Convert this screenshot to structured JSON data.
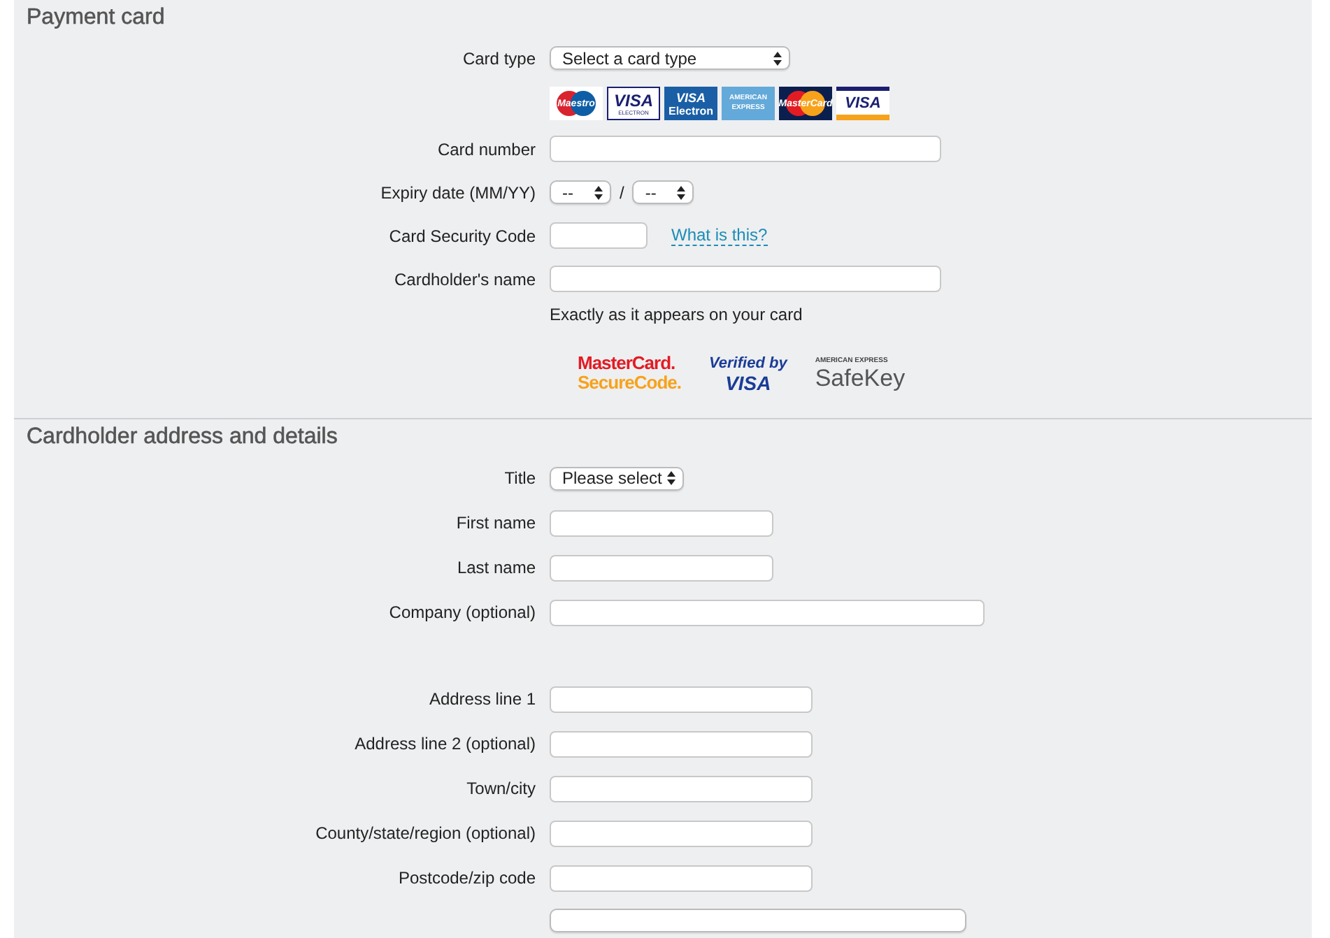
{
  "payment_card": {
    "title": "Payment card",
    "card_type": {
      "label": "Card type",
      "value": "Select a card type"
    },
    "card_logos": [
      {
        "kind": "maestro",
        "label": "Maestro"
      },
      {
        "kind": "visa",
        "label": "VISA",
        "sub": "ELECTRON"
      },
      {
        "kind": "electron",
        "label": "VISA",
        "sub": "Electron"
      },
      {
        "kind": "amex",
        "label": "AMERICAN",
        "sub": "EXPRESS"
      },
      {
        "kind": "mastercard",
        "label": "MasterCard"
      },
      {
        "kind": "visa2",
        "label": "VISA"
      }
    ],
    "card_number": {
      "label": "Card number"
    },
    "expiry": {
      "label": "Expiry date (MM/YY)",
      "month": "--",
      "separator": "/",
      "year": "--"
    },
    "security_code": {
      "label": "Card Security Code",
      "help_link": "What is this?"
    },
    "cardholder_name": {
      "label": "Cardholder's name",
      "hint": "Exactly as it appears on your card"
    },
    "security_logos": [
      {
        "kind": "mastercard",
        "lines": [
          "MasterCard.",
          "SecureCode."
        ]
      },
      {
        "kind": "visa",
        "lines": [
          "Verified by",
          "VISA"
        ]
      },
      {
        "kind": "amex",
        "lines": [
          "AMERICAN EXPRESS",
          "SafeKey"
        ]
      }
    ]
  },
  "cardholder_address": {
    "title": "Cardholder address and details",
    "fields": [
      {
        "kind": "select",
        "label": "Title",
        "value": "Please select"
      },
      {
        "kind": "text",
        "label": "First name"
      },
      {
        "kind": "text",
        "label": "Last name"
      },
      {
        "kind": "text",
        "label": "Company (optional)"
      },
      {
        "kind": "spacer"
      },
      {
        "kind": "text",
        "label": "Address line 1"
      },
      {
        "kind": "text",
        "label": "Address line 2 (optional)"
      },
      {
        "kind": "text",
        "label": "Town/city"
      },
      {
        "kind": "text",
        "label": "County/state/region (optional)"
      },
      {
        "kind": "text",
        "label": "Postcode/zip code"
      },
      {
        "kind": "cut-select"
      }
    ]
  }
}
